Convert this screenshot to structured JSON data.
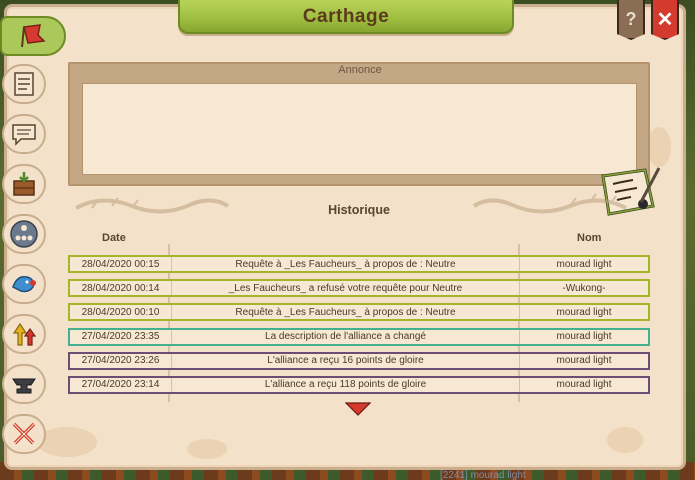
{
  "window": {
    "title": "Carthage"
  },
  "top_buttons": {
    "help_label": "?",
    "close_label": "✕"
  },
  "sidebar": {
    "items": [
      {
        "icon": "alliance-flag-icon",
        "active": true
      },
      {
        "icon": "member-list-icon"
      },
      {
        "icon": "chat-icon"
      },
      {
        "icon": "crate-icon"
      },
      {
        "icon": "hierarchy-icon"
      },
      {
        "icon": "dragon-icon"
      },
      {
        "icon": "upgrade-arrows-icon"
      },
      {
        "icon": "anvil-icon"
      },
      {
        "icon": "crossed-swords-icon"
      }
    ]
  },
  "announcement": {
    "label": "Annonce",
    "text": ""
  },
  "history": {
    "title": "Historique",
    "columns": {
      "date": "Date",
      "name": "Nom"
    },
    "rows": [
      {
        "date": "28/04/2020 00:15",
        "description": "Requête à _Les Faucheurs_ à propos de : Neutre",
        "name": "mourad light",
        "color": "#a6b42c"
      },
      {
        "date": "28/04/2020 00:14",
        "description": "_Les Faucheurs_ a refusé votre requête pour Neutre",
        "name": "-Wukong-",
        "color": "#a6b42c"
      },
      {
        "date": "28/04/2020 00:10",
        "description": "Requête à _Les Faucheurs_ à propos de : Neutre",
        "name": "mourad light",
        "color": "#a6b42c"
      },
      {
        "date": "27/04/2020 23:35",
        "description": "La description de l'alliance a changé",
        "name": "mourad light",
        "color": "#45b08f"
      },
      {
        "date": "27/04/2020 23:26",
        "description": "L'alliance a reçu 16 points de gloire",
        "name": "mourad light",
        "color": "#6d4d74"
      },
      {
        "date": "27/04/2020 23:14",
        "description": "L'alliance a reçu 118 points de gloire",
        "name": "mourad light",
        "color": "#6d4d74"
      }
    ]
  },
  "background": {
    "chat_snippet": "[2241] mourad light"
  },
  "colors": {
    "parchment": "#f3e1c9",
    "banner_green": "#9ebd3f",
    "close_red": "#d53a2e",
    "row_green": "#a6b42c",
    "row_teal": "#45b08f",
    "row_purple": "#6d4d74"
  }
}
